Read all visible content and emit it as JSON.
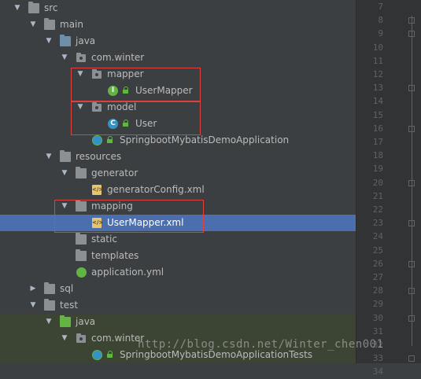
{
  "tree": {
    "items": [
      {
        "label": "src"
      },
      {
        "label": "main"
      },
      {
        "label": "java"
      },
      {
        "label": "com.winter"
      },
      {
        "label": "mapper"
      },
      {
        "label": "UserMapper"
      },
      {
        "label": "model"
      },
      {
        "label": "User"
      },
      {
        "label": "SpringbootMybatisDemoApplication"
      },
      {
        "label": "resources"
      },
      {
        "label": "generator"
      },
      {
        "label": "generatorConfig.xml"
      },
      {
        "label": "mapping"
      },
      {
        "label": "UserMapper.xml"
      },
      {
        "label": "static"
      },
      {
        "label": "templates"
      },
      {
        "label": "application.yml"
      },
      {
        "label": "sql"
      },
      {
        "label": "test"
      },
      {
        "label": "java"
      },
      {
        "label": "com.winter"
      },
      {
        "label": "SpringbootMybatisDemoApplicationTests"
      }
    ],
    "selected": "UserMapper.xml"
  },
  "gutter": {
    "line_numbers": [
      "7",
      "8",
      "9",
      "10",
      "11",
      "12",
      "13",
      "14",
      "15",
      "16",
      "17",
      "18",
      "19",
      "20",
      "21",
      "22",
      "23",
      "24",
      "25",
      "26",
      "27",
      "28",
      "29",
      "30",
      "31",
      "32",
      "33",
      "34"
    ]
  },
  "icons": {
    "interface": "I",
    "class": "C",
    "xml": "</>"
  },
  "watermark": "http://blog.csdn.net/Winter_chen001",
  "colors": {
    "selection": "#4b6eaf",
    "highlight_box": "#e0413f",
    "interface_icon": "#62b543",
    "class_icon": "#3592c4"
  }
}
